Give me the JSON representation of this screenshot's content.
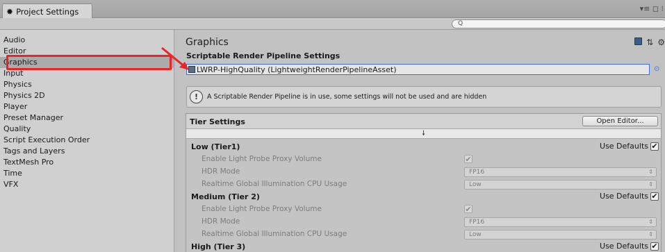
{
  "window": {
    "tab_title": "Project Settings",
    "controls": "▾≡ ◻ ⁝"
  },
  "search": {
    "placeholder": "Q"
  },
  "sidebar": {
    "items": [
      {
        "label": "Audio"
      },
      {
        "label": "Editor"
      },
      {
        "label": "Graphics",
        "active": true
      },
      {
        "label": "Input"
      },
      {
        "label": "Physics"
      },
      {
        "label": "Physics 2D"
      },
      {
        "label": "Player"
      },
      {
        "label": "Preset Manager"
      },
      {
        "label": "Quality"
      },
      {
        "label": "Script Execution Order"
      },
      {
        "label": "Tags and Layers"
      },
      {
        "label": "TextMesh Pro"
      },
      {
        "label": "Time"
      },
      {
        "label": "VFX"
      }
    ]
  },
  "main": {
    "title": "Graphics",
    "srp_label": "Scriptable Render Pipeline Settings",
    "asset_value": "LWRP-HighQuality (LightweightRenderPipelineAsset)",
    "help_text": "A Scriptable Render Pipeline is in use, some settings will not be used and are hidden",
    "tier_settings_label": "Tier Settings",
    "open_editor_label": "Open Editor...",
    "download_icon": "🠗"
  },
  "tiers": [
    {
      "name": "Low (Tier1)",
      "use_defaults": "Use Defaults",
      "probe_label": "Enable Light Probe Proxy Volume",
      "hdr_label": "HDR Mode",
      "hdr_value": "FP16",
      "gi_label": "Realtime Global Illumination CPU Usage",
      "gi_value": "Low"
    },
    {
      "name": "Medium (Tier 2)",
      "use_defaults": "Use Defaults",
      "probe_label": "Enable Light Probe Proxy Volume",
      "hdr_label": "HDR Mode",
      "hdr_value": "FP16",
      "gi_label": "Realtime Global Illumination CPU Usage",
      "gi_value": "Low"
    },
    {
      "name": "High (Tier 3)",
      "use_defaults": "Use Defaults"
    }
  ],
  "colors": {
    "highlight_red": "#e8262a",
    "field_blue": "#3d6fd1"
  }
}
